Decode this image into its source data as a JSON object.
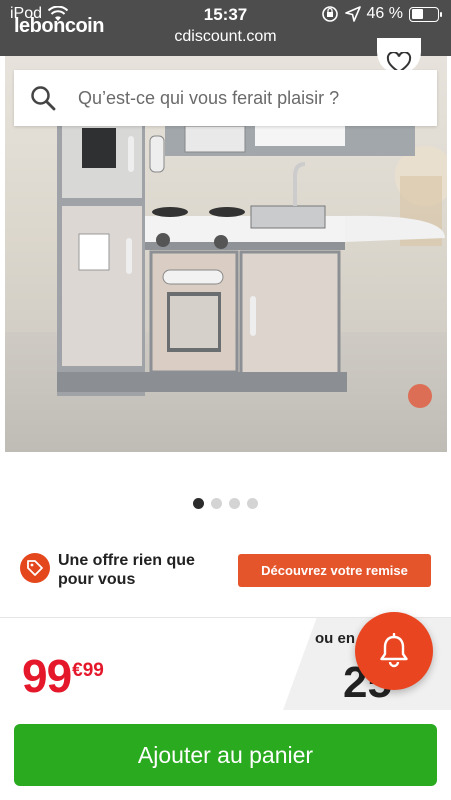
{
  "status_bar": {
    "carrier": "iPod",
    "time": "15:37",
    "url": "cdiscount.com",
    "battery": "46 %",
    "battery_level": 0.46
  },
  "overlay_logo": "leboncoin",
  "search": {
    "placeholder": "Qu’est-ce qui vous ferait plaisir ?"
  },
  "carousel": {
    "total": 4,
    "active": 1
  },
  "offer": {
    "text": "Une offre rien que pour vous",
    "button": "Découvrez votre remise"
  },
  "price": {
    "integer": "99",
    "cents": "€99"
  },
  "alt_price": {
    "label": "ou en",
    "amount": "25"
  },
  "cart": {
    "button": "Ajouter au panier"
  },
  "colors": {
    "status_bg": "#4d4d4d",
    "price_red": "#e4172b",
    "offer_orange": "#e5552b",
    "bell_orange": "#ea4521",
    "cart_green": "#2aaa1f"
  }
}
